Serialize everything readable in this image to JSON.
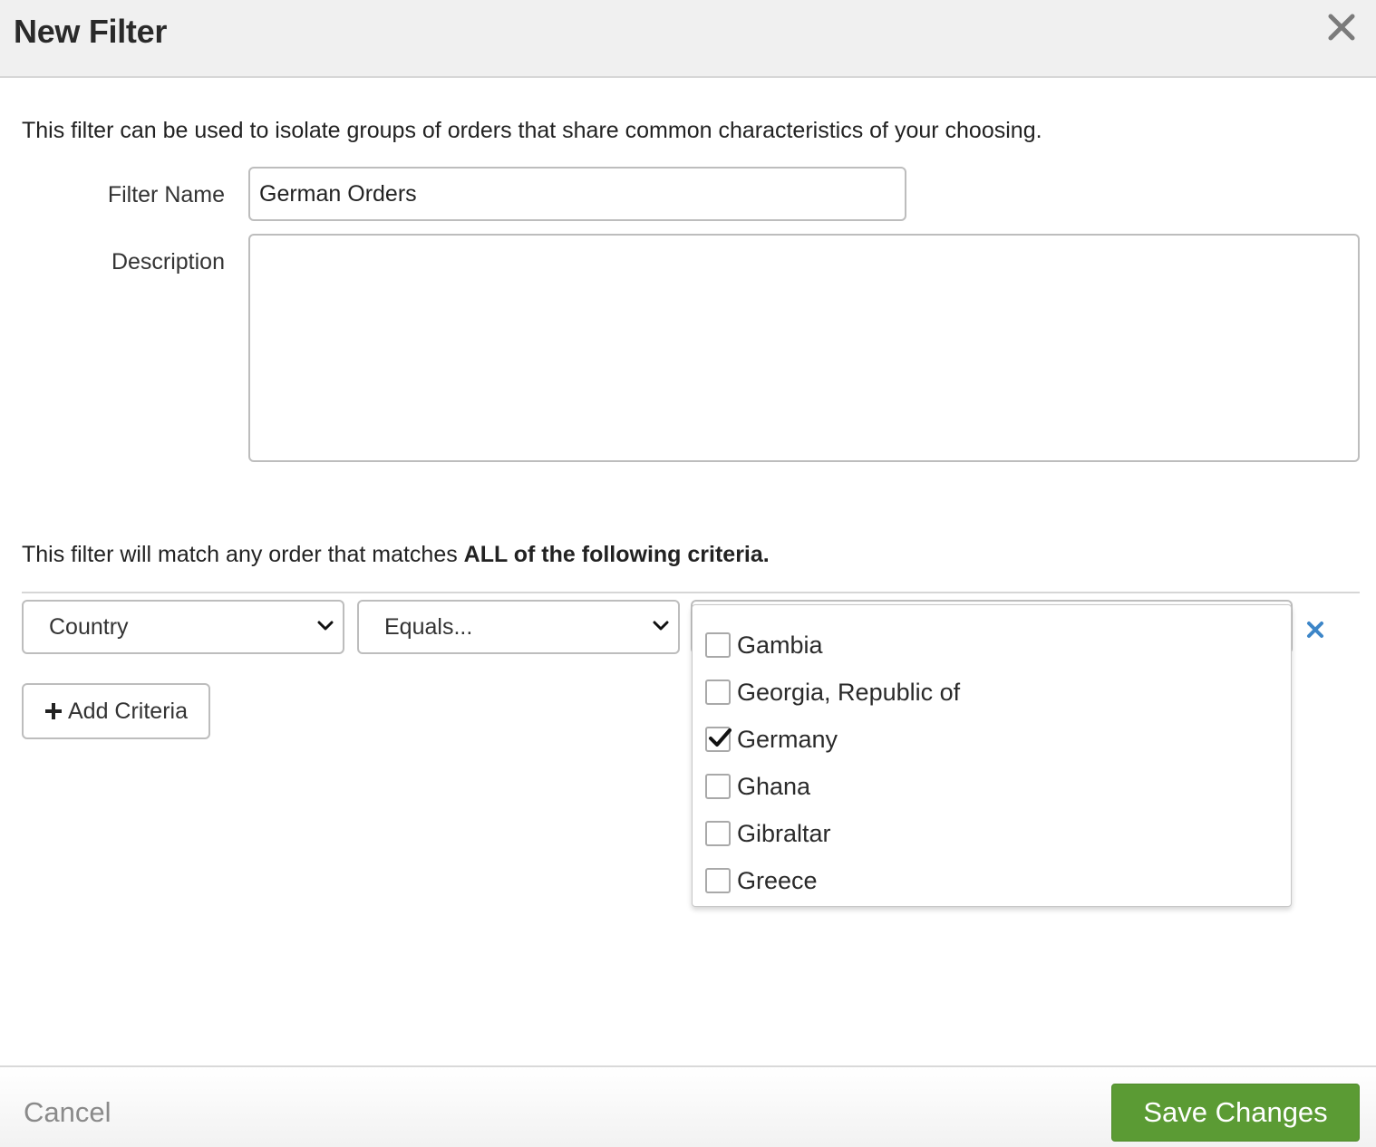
{
  "dialog": {
    "title": "New Filter",
    "intro": "This filter can be used to isolate groups of orders that share common characteristics of your choosing."
  },
  "form": {
    "filter_name_label": "Filter Name",
    "filter_name_value": "German Orders",
    "description_label": "Description",
    "description_value": ""
  },
  "criteria": {
    "intro_prefix": "This filter will match any order that matches ",
    "intro_bold": "ALL of the following criteria.",
    "field_select": "Country",
    "operator_select": "Equals...",
    "add_label": "Add Criteria",
    "options": [
      {
        "label": "Gambia",
        "checked": false
      },
      {
        "label": "Georgia, Republic of",
        "checked": false
      },
      {
        "label": "Germany",
        "checked": true
      },
      {
        "label": "Ghana",
        "checked": false
      },
      {
        "label": "Gibraltar",
        "checked": false
      },
      {
        "label": "Greece",
        "checked": false
      }
    ]
  },
  "footer": {
    "cancel_label": "Cancel",
    "save_label": "Save Changes"
  },
  "colors": {
    "save_button": "#5b9b34",
    "remove_icon": "#3d86c8",
    "header_bg": "#f0f0f0"
  },
  "icons": {
    "close": "close-icon",
    "remove": "remove-criteria-icon",
    "add": "plus-icon",
    "chevron": "chevron-down-icon",
    "check": "checkmark-icon"
  }
}
